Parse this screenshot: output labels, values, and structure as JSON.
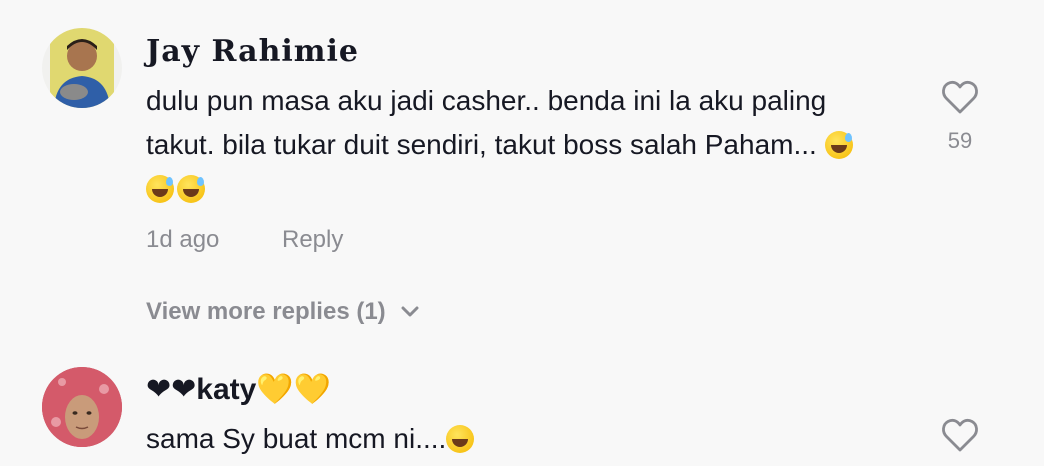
{
  "comments": [
    {
      "username": "Jay Rahimie",
      "text": "dulu pun masa aku jadi casher.. benda ini la aku paling takut. bila tukar duit sendiri, takut boss salah Paham...",
      "emoji_icons": [
        "sweat-smile-emoji",
        "sweat-smile-emoji",
        "sweat-smile-emoji"
      ],
      "time": "1d ago",
      "reply_label": "Reply",
      "likes": "59",
      "view_more_replies": "View more replies (1)"
    },
    {
      "username_prefix": "❤❤",
      "username_name": "katy",
      "username_suffix": "💛💛",
      "text": "sama Sy buat mcm ni....",
      "emoji_icons": [
        "grin-emoji"
      ]
    }
  ],
  "colors": {
    "background": "#f8f8f8",
    "primary_text": "#161823",
    "secondary_text": "#8a8b91"
  }
}
